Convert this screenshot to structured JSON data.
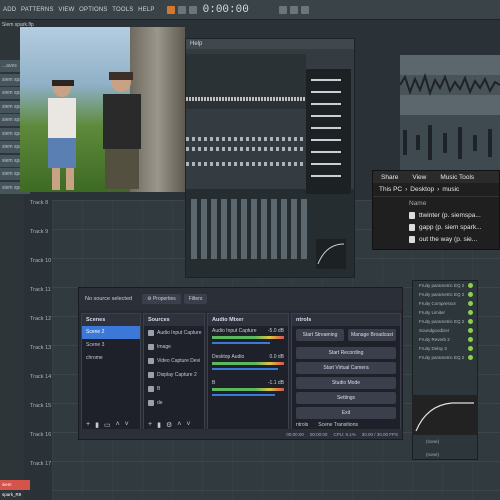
{
  "topbar": {
    "menu": [
      "ADD",
      "PATTERNS",
      "VIEW",
      "OPTIONS",
      "TOOLS",
      "HELP"
    ],
    "time": "0:00:00"
  },
  "sidebar": {
    "title": "Siem spark.flp",
    "tracks": [
      "...aves",
      "siem spark_R1",
      "siem spark_R2",
      "siem spark_R3",
      "siem spark_R4",
      "siem spark_R5",
      "siem spark_R6",
      "siem spark_R7",
      "siem spark_R8",
      "siem spark_R9"
    ]
  },
  "playlist": {
    "track_labels": [
      "Track 8",
      "Track 9",
      "Track 10",
      "Track 11",
      "Track 12",
      "Track 13",
      "Track 14",
      "Track 15",
      "Track 16",
      "Track 17"
    ]
  },
  "fl_window": {
    "menu_label": "Help"
  },
  "explorer": {
    "tabs": [
      "Share",
      "View",
      "Music Tools"
    ],
    "address": [
      "This PC",
      "Desktop",
      "music"
    ],
    "column": "Name",
    "files": [
      "ttwinter (p. siemspa...",
      "gapp (p. siem spark...",
      "out the way (p. sie..."
    ]
  },
  "obs": {
    "top": {
      "no_source": "No source selected",
      "properties": "Properties",
      "filters": "Filters"
    },
    "scenes": {
      "title": "Scenes",
      "items": [
        "Scene 2",
        "Scene 3",
        "chrome"
      ],
      "selected": 0
    },
    "sources": {
      "title": "Sources",
      "items": [
        "Audio Input Capture",
        "Image",
        "Video Capture Devi",
        "Display Capture 2",
        "B",
        "de"
      ]
    },
    "mixer": {
      "title": "Audio Mixer",
      "channels": [
        {
          "name": "Audio Input Capture",
          "db": "-5.0 dB"
        },
        {
          "name": "Desktop Audio",
          "db": "0.0 dB"
        },
        {
          "name": "B",
          "db": "-1.1 dB"
        }
      ]
    },
    "controls": {
      "title": "ntrols",
      "start_streaming": "Start Streaming",
      "manage_broadcast": "Manage Broadcast",
      "start_recording": "Start Recording",
      "start_virtual_camera": "Start Virtual Camera",
      "studio_mode": "Studio Mode",
      "settings": "Settings",
      "exit": "Exit",
      "tab_controls": "ntrols",
      "tab_transitions": "Scene Transitions"
    },
    "status": {
      "time1": "00:00:00",
      "time2": "00:00:00",
      "cpu": "CPU: 8.1%",
      "fps": "30.00 / 30.00 FPS"
    }
  },
  "plugins": {
    "items": [
      "Fruity parametric EQ 2",
      "Fruity parametric EQ 2",
      "Fruity Compressor",
      "Fruity Limiter",
      "Fruity parametric EQ 2",
      "Soundgoodizer",
      "Fruity Reverb 2",
      "Fruity Delay 3",
      "Fruity parametric EQ 2"
    ],
    "slots": [
      "(none)",
      "(none)"
    ]
  },
  "bottom_track": "siem spark_R9"
}
